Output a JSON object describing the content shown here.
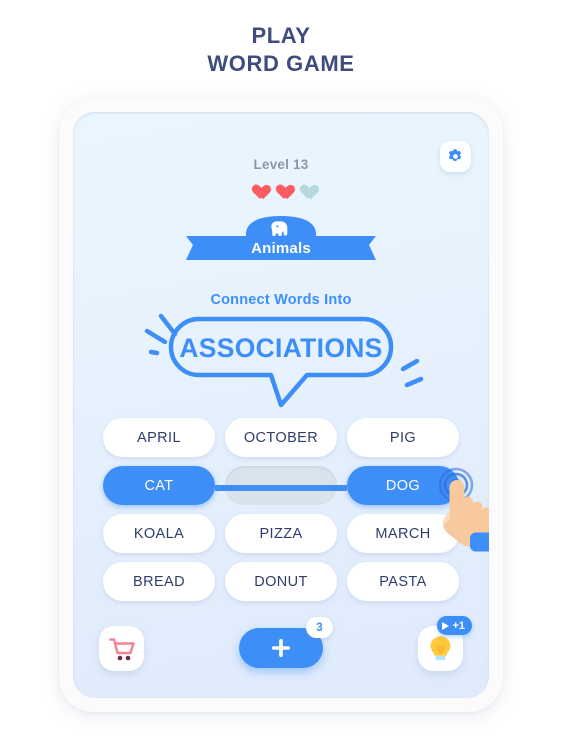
{
  "header": {
    "line1": "PLAY",
    "line2": "WORD GAME"
  },
  "game": {
    "level_label": "Level 13",
    "lives": {
      "total": 3,
      "remaining": 2
    },
    "category": {
      "label": "Animals",
      "icon": "elephant-icon"
    },
    "settings_icon": "gear-icon",
    "prompt": {
      "subtitle": "Connect Words Into",
      "title": "ASSOCIATIONS"
    },
    "words": [
      {
        "label": "APRIL",
        "state": "normal"
      },
      {
        "label": "OCTOBER",
        "state": "normal"
      },
      {
        "label": "PIG",
        "state": "normal"
      },
      {
        "label": "CAT",
        "state": "selected"
      },
      {
        "label": "",
        "state": "empty"
      },
      {
        "label": "DOG",
        "state": "selected"
      },
      {
        "label": "KOALA",
        "state": "normal"
      },
      {
        "label": "PIZZA",
        "state": "normal"
      },
      {
        "label": "MARCH",
        "state": "normal"
      },
      {
        "label": "BREAD",
        "state": "normal"
      },
      {
        "label": "DONUT",
        "state": "normal"
      },
      {
        "label": "PASTA",
        "state": "normal"
      }
    ],
    "toolbar": {
      "shop_icon": "shopping-cart-icon",
      "add_icon": "plus-icon",
      "add_badge": "3",
      "hint_icon": "lightbulb-icon",
      "hint_badge": "+1",
      "hint_badge_icon": "play-icon"
    }
  },
  "colors": {
    "accent_blue": "#3d8ef7",
    "header_navy": "#3f4d7e",
    "word_navy": "#2f3d6b",
    "heart_red": "#fc5b62",
    "heart_empty": "#b8d8e0",
    "cart_pink": "#f6808f",
    "bulb_yellow": "#ffc93c",
    "panel_bg": "#e6f1fd"
  }
}
